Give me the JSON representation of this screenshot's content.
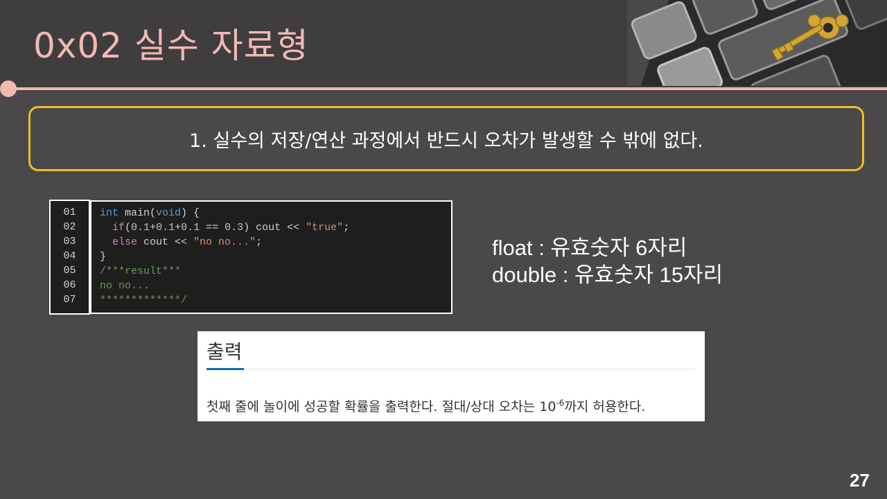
{
  "slide": {
    "title": "0x02  실수 자료형",
    "page_number": "27",
    "accent_color": "#f2b8b4",
    "callout_border_color": "#f2bd2a"
  },
  "callout": {
    "text": "1. 실수의 저장/연산 과정에서 반드시 오차가 발생할 수 밖에 없다."
  },
  "code": {
    "line_numbers": [
      "01",
      "02",
      "03",
      "04",
      "05",
      "06",
      "07"
    ],
    "lines": [
      [
        {
          "t": "int",
          "c": "c-kw"
        },
        {
          "t": " main(",
          "c": "c-txt"
        },
        {
          "t": "void",
          "c": "c-kw"
        },
        {
          "t": ") {",
          "c": "c-txt"
        }
      ],
      [
        {
          "t": "  ",
          "c": "c-txt"
        },
        {
          "t": "if",
          "c": "c-pink"
        },
        {
          "t": "(",
          "c": "c-txt"
        },
        {
          "t": "0.1",
          "c": "c-num"
        },
        {
          "t": "+",
          "c": "c-txt"
        },
        {
          "t": "0.1",
          "c": "c-num"
        },
        {
          "t": "+",
          "c": "c-txt"
        },
        {
          "t": "0.1",
          "c": "c-num"
        },
        {
          "t": " == ",
          "c": "c-txt"
        },
        {
          "t": "0.3",
          "c": "c-num"
        },
        {
          "t": ") cout << ",
          "c": "c-txt"
        },
        {
          "t": "\"true\"",
          "c": "c-str"
        },
        {
          "t": ";",
          "c": "c-txt"
        }
      ],
      [
        {
          "t": "  ",
          "c": "c-txt"
        },
        {
          "t": "else",
          "c": "c-pink"
        },
        {
          "t": " cout << ",
          "c": "c-txt"
        },
        {
          "t": "\"no no...\"",
          "c": "c-str"
        },
        {
          "t": ";",
          "c": "c-txt"
        }
      ],
      [
        {
          "t": "}",
          "c": "c-txt"
        }
      ],
      [
        {
          "t": "/***result***",
          "c": "c-cmt"
        }
      ],
      [
        {
          "t": "no no...",
          "c": "c-cmt"
        }
      ],
      [
        {
          "t": "*************/",
          "c": "c-cmt"
        }
      ]
    ]
  },
  "precision_notes": {
    "float": "float : 유효숫자 6자리",
    "double": "double : 유효숫자 15자리"
  },
  "output_panel": {
    "heading": "출력",
    "text_before": "첫째 줄에 놀이에 성공할 확률을 출력한다. 절대/상대 오차는 10",
    "exponent": "-6",
    "text_after": "까지 허용한다."
  },
  "icons": {
    "corner_image": "keyboard-golden-key-photo"
  }
}
